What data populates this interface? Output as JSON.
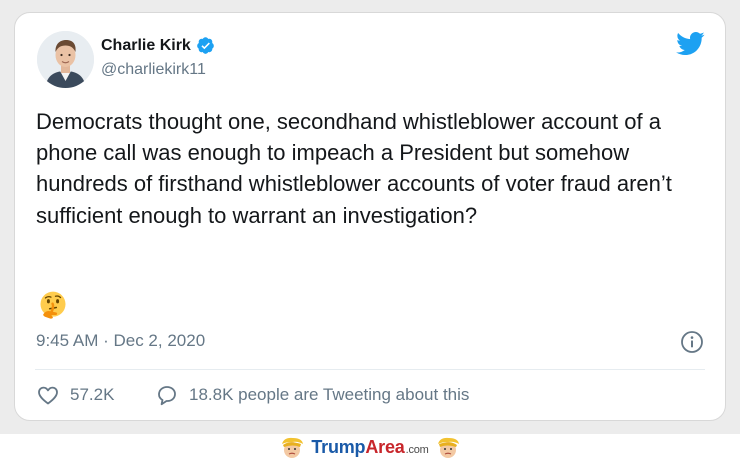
{
  "tweet": {
    "author_name": "Charlie Kirk",
    "author_handle": "@charliekirk11",
    "text": "Democrats thought one, secondhand whistleblower account of a phone call was enough to impeach a President but somehow hundreds of firsthand whistleblower accounts of voter fraud aren’t sufficient enough to warrant an investigation?",
    "emoji": "thinking-face",
    "timestamp": "9:45 AM · Dec 2, 2020",
    "like_count": "57.2K",
    "conversation_text": "18.8K people are Tweeting about this"
  },
  "icons": {
    "verified": "verified-badge-icon",
    "logo": "twitter-bird-icon",
    "info": "info-icon",
    "like": "heart-icon",
    "conversation": "speech-bubble-icon"
  },
  "footer": {
    "brand_part1": "Trump",
    "brand_part2": "Area",
    "brand_part3": ".com"
  },
  "colors": {
    "twitter_blue": "#1da1f2",
    "text_primary": "#14171a",
    "text_secondary": "#657786",
    "brand_blue": "#1a5aa8",
    "brand_red": "#c8262b"
  }
}
